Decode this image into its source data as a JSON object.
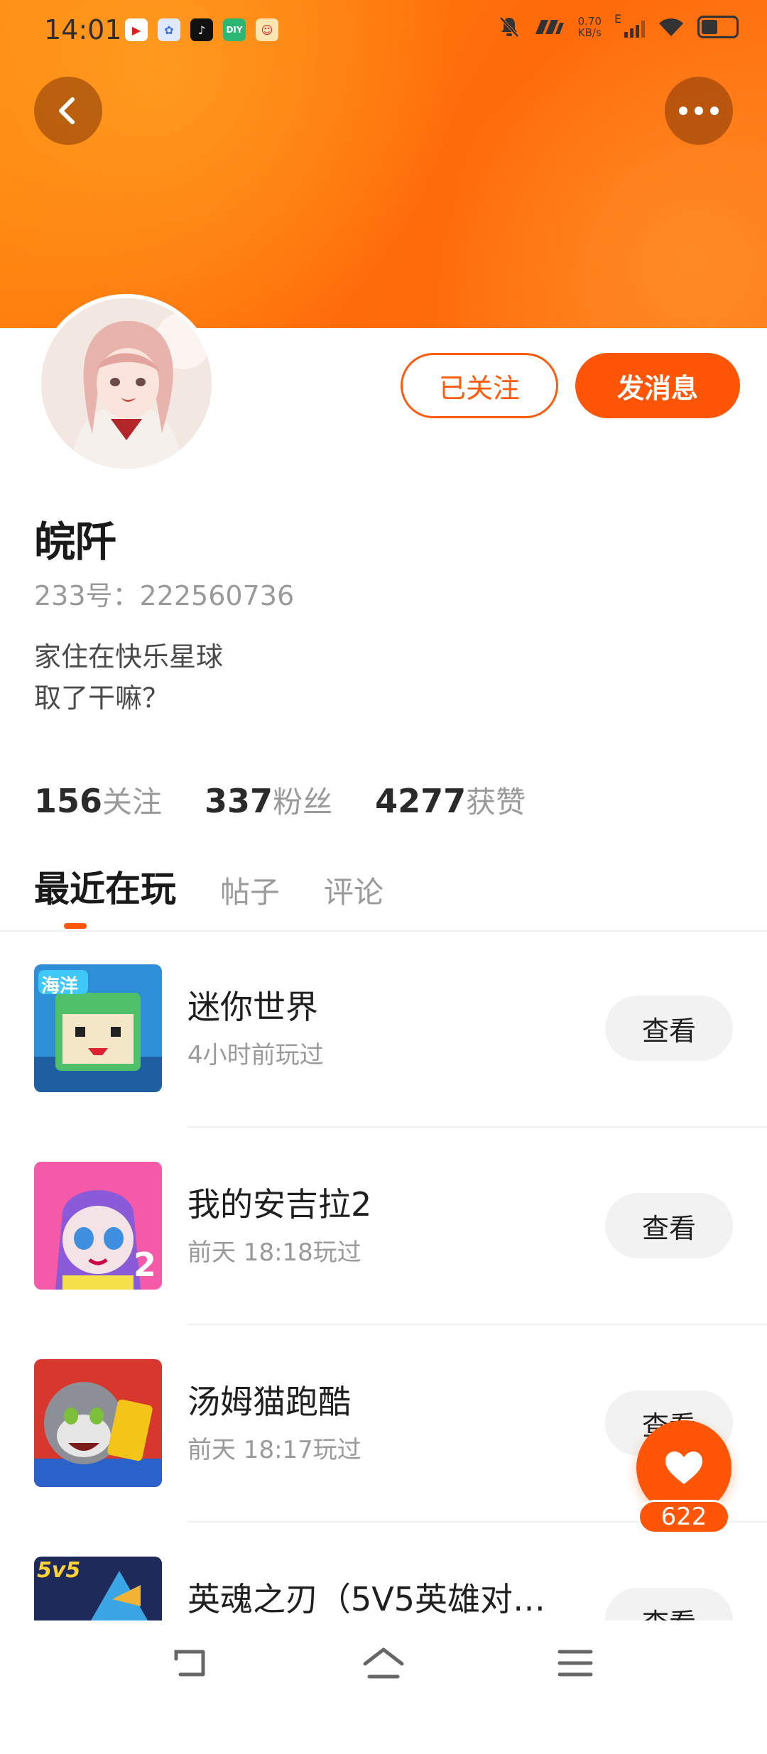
{
  "status_bar": {
    "time": "14:01",
    "net_speed_value": "0.70",
    "net_speed_unit": "KB/s",
    "network_type": "E",
    "battery_level": 0.55
  },
  "header": {
    "back_icon": "back-arrow-icon",
    "more_icon": "more-dots-icon",
    "accent_color": "#ff5506"
  },
  "profile": {
    "follow_label": "已关注",
    "message_label": "发消息",
    "name": "皖阡",
    "id_text": "233号：222560736",
    "bio_line1": "家住在快乐星球",
    "bio_line2": "取了干嘛？"
  },
  "stats": [
    {
      "num": "156",
      "label": "关注"
    },
    {
      "num": "337",
      "label": "粉丝"
    },
    {
      "num": "4277",
      "label": "获赞"
    }
  ],
  "tabs": [
    "最近在玩",
    "帖子",
    "评论"
  ],
  "games": [
    {
      "name": "迷你世界",
      "sub": "4小时前玩过",
      "button": "查看",
      "badge": "海洋"
    },
    {
      "name": "我的安吉拉2",
      "sub": "前天 18:18玩过",
      "button": "查看"
    },
    {
      "name": "汤姆猫跑酷",
      "sub": "前天 18:17玩过",
      "button": "查看"
    },
    {
      "name": "英魂之刃（5V5英雄对…",
      "sub": "",
      "button": "查看",
      "badge": "5v5"
    }
  ],
  "like": {
    "count": "622",
    "icon": "heart-icon"
  },
  "nav": {
    "back_icon": "nav-back-icon",
    "home_icon": "nav-home-icon",
    "menu_icon": "nav-menu-icon"
  }
}
